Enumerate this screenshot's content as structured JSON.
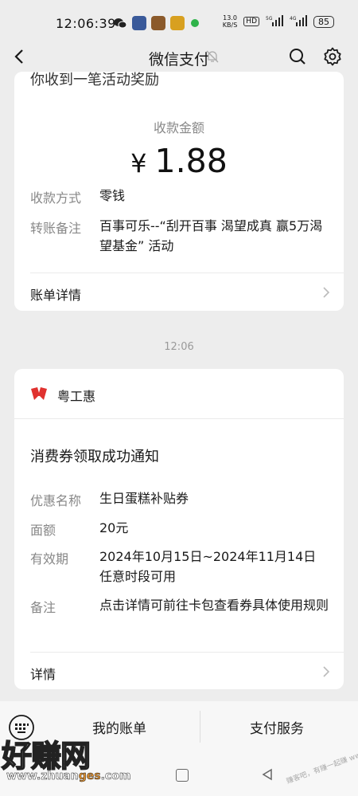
{
  "status_bar": {
    "time": "12:06:39",
    "net_speed_value": "13.0",
    "net_speed_unit": "KB/S",
    "hd_badge": "HD",
    "signal1": "⁵ᴳ",
    "signal2": "⁴ᴳ",
    "battery": "85"
  },
  "nav": {
    "title": "微信支付"
  },
  "card1": {
    "top_text": "你收到一笔活动奖励",
    "amount_label": "收款金额",
    "currency": "¥",
    "amount": "1.88",
    "rows": [
      {
        "label": "收款方式",
        "value": "零钱"
      },
      {
        "label": "转账备注",
        "value": "百事可乐--“刮开百事 渴望成真 赢5万渴望基金” 活动"
      }
    ],
    "link": "账单详情"
  },
  "timestamp": "12:06",
  "card2": {
    "source_name": "粤工惠",
    "title": "消费券领取成功通知",
    "rows": [
      {
        "label": "优惠名称",
        "value": "生日蛋糕补贴券"
      },
      {
        "label": "面额",
        "value": "20元"
      },
      {
        "label": "有效期",
        "value": "2024年10月15日~2024年11月14日任意时段可用"
      },
      {
        "label": "备注",
        "value": "点击详情可前往卡包查看券具体使用规则"
      }
    ],
    "link": "详情"
  },
  "bottom_menu": {
    "item1": "我的账单",
    "item2": "支付服务"
  },
  "watermark": {
    "big": "好赚网",
    "url_pre": "www.zhuan",
    "url_hl": "ges",
    "url_post": ".com",
    "small": "赚客吧，有赚一起赚  www.zuanke8.com"
  },
  "colors": {
    "background": "#ededed",
    "card": "#ffffff",
    "secondary_text": "#888888",
    "logo_red": "#e0322f"
  }
}
